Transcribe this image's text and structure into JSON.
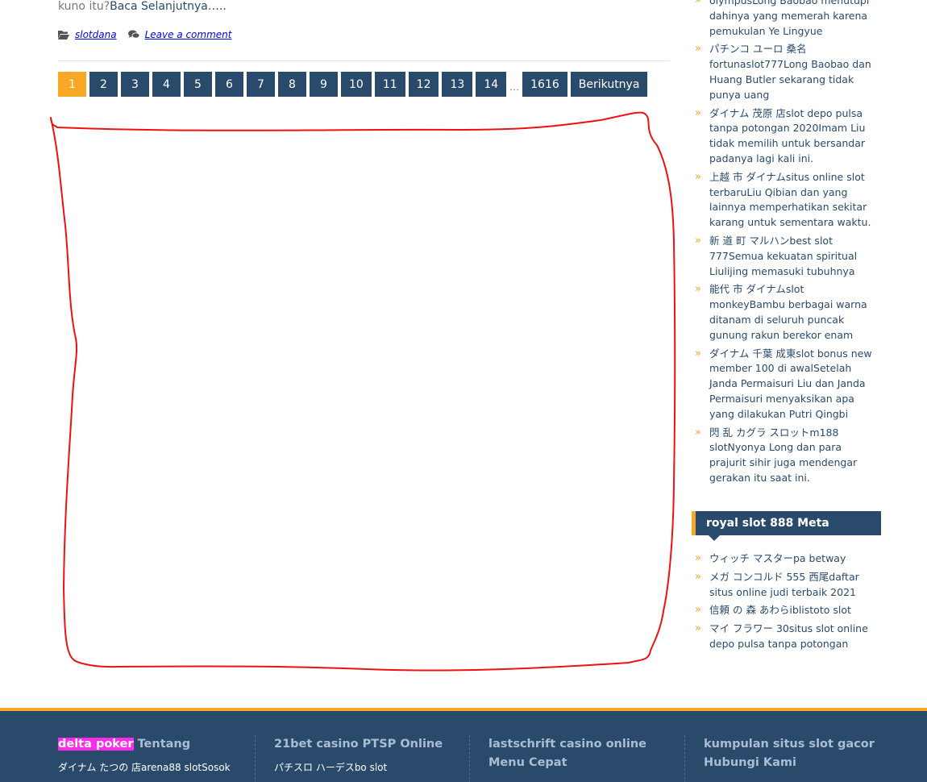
{
  "excerpt": {
    "text": "kuno itu?",
    "read_more": "Baca Selanjutnya….."
  },
  "meta": {
    "category": "slotdana",
    "comment": "Leave a comment"
  },
  "pagination": {
    "pages": [
      "1",
      "2",
      "3",
      "4",
      "5",
      "6",
      "7",
      "8",
      "9",
      "10",
      "11",
      "12",
      "13",
      "14"
    ],
    "current": "1",
    "dots": "…",
    "last": "1616",
    "next": "Berikutnya"
  },
  "sidebar": {
    "recent": [
      "olympusLong Baobao menutupi dahinya yang memerah karena pemukulan Ye Lingyue",
      "パチンコ ユーロ 桑名fortunaslot777Long Baobao dan Huang Butler sekarang tidak punya uang",
      "ダイナム 茂原 店slot depo pulsa tanpa potongan 2020Imam Liu tidak memilih untuk bersandar padanya lagi kali ini.",
      "上越 市 ダイナムsitus online slot terbaruLiu Qibian dan yang lainnya memperhatikan sekitar karang untuk sementara waktu.",
      "新 道 町 マルハンbest slot 777Semua kekuatan spiritual Liulijing memasuki tubuhnya",
      "能代 市 ダイナムslot monkeyBambu berbagai warna ditanam di seluruh puncak gunung rakun berekor enam",
      "ダイナム 千葉 成東slot bonus new member 100 di awalSetelah Janda Permaisuri Liu dan Janda Permaisuri menyaksikan apa yang dilakukan Putri Qingbi",
      "閃 乱 カグラ スロットm188 slotNyonya Long dan para prajurit sihir juga mendengar gerakan itu saat ini."
    ],
    "meta_title": "royal slot 888 Meta",
    "meta_items": [
      "ウィッチ マスターpa betway",
      "メガ コンコルド 555 西尾daftar situs online judi terbaik 2021",
      "信頼 の 森 あわらiblistoto slot",
      "マイ フラワー 30situs slot online depo pulsa tanpa potongan"
    ]
  },
  "footer": {
    "col1": {
      "highlight": "delta poker",
      "title": " Tentang",
      "text": "ダイナム たつの 店arena88 slotSosok"
    },
    "col2": {
      "title": "21bet casino PTSP Online",
      "text": "パチスロ ハーデスbo slot"
    },
    "col3": {
      "title": "lastschrift casino online Menu Cepat"
    },
    "col4": {
      "title": "kumpulan situs slot gacor Hubungi Kami"
    }
  },
  "colors": {
    "navy": "#2a4a6b",
    "accent": "#f9a826",
    "highlight": "#ff2bea",
    "scribble": "#ee1111"
  }
}
